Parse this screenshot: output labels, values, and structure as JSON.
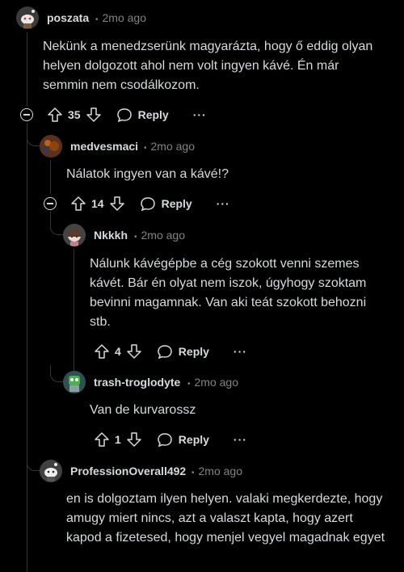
{
  "comments": [
    {
      "username": "poszata",
      "time": "2mo ago",
      "text": "Nekünk a menedzserünk magyarázta, hogy ő eddig olyan helyen dolgozott ahol nem volt ingyen kávé. Én már semmin nem csodálkozom.",
      "votes": "35",
      "reply": "Reply",
      "more": "···"
    },
    {
      "username": "medvesmaci",
      "time": "2mo ago",
      "text": "Nálatok ingyen van a kávé!?",
      "votes": "14",
      "reply": "Reply",
      "more": "···"
    },
    {
      "username": "Nkkkh",
      "time": "2mo ago",
      "text": "Nálunk kávégépbe a cég szokott venni szemes kávét. Bár én olyat nem iszok, úgyhogy szoktam bevinni magamnak. Van aki teát szokott behozni stb.",
      "votes": "4",
      "reply": "Reply",
      "more": "···"
    },
    {
      "username": "trash-troglodyte",
      "time": "2mo ago",
      "text": "Van de kurvarossz",
      "votes": "1",
      "reply": "Reply",
      "more": "···"
    },
    {
      "username": "ProfessionOverall492",
      "time": "2mo ago",
      "text": "en is dolgoztam ilyen helyen. valaki megkerdezte, hogy amugy miert nincs, azt a valaszt kapta, hogy azert kapod a fizetesed, hogy menjel vegyel magadnak egyet"
    }
  ],
  "separator": "•",
  "colors": {
    "background": "#000000",
    "text": "#d7dadc",
    "muted": "#818384",
    "thread_line": "#343536"
  }
}
